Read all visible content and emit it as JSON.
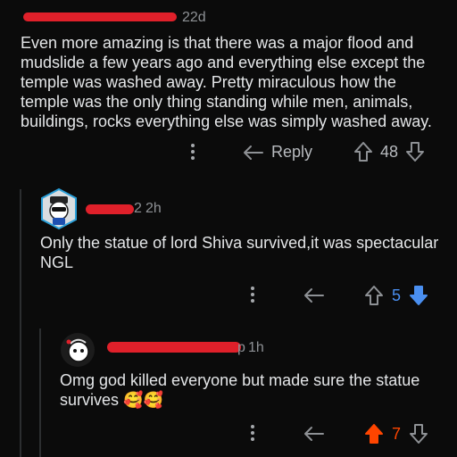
{
  "colors": {
    "background": "#0b0b0b",
    "text": "#e4e6e8",
    "meta": "#8e9195",
    "upvote_active": "#ff4500",
    "downvote_active": "#4a8ff0",
    "redaction": "#e0202a"
  },
  "comments": [
    {
      "id": "c1",
      "timestamp": "22d",
      "body": "Even more amazing is that there was a major flood and mudslide a few years ago and everything else except the temple was washed away. Pretty miraculous how the temple was the only thing standing while men, animals, buildings, rocks everything else was simply washed away.",
      "reply_label": "Reply",
      "score": "48",
      "vote_state": "none"
    },
    {
      "id": "c2",
      "username_visible": "2",
      "timestamp": "2h",
      "body": "Only the statue of lord Shiva survived,it was spectacular NGL",
      "score": "5",
      "vote_state": "downvoted"
    },
    {
      "id": "c3",
      "username_visible": "p",
      "timestamp": "1h",
      "body": "Omg god killed everyone but made sure the statue survives",
      "emoji": "🥰🥰",
      "score": "7",
      "vote_state": "upvoted"
    }
  ],
  "icons": [
    "more-icon",
    "reply-arrow-icon",
    "upvote-icon",
    "downvote-icon",
    "avatar"
  ]
}
